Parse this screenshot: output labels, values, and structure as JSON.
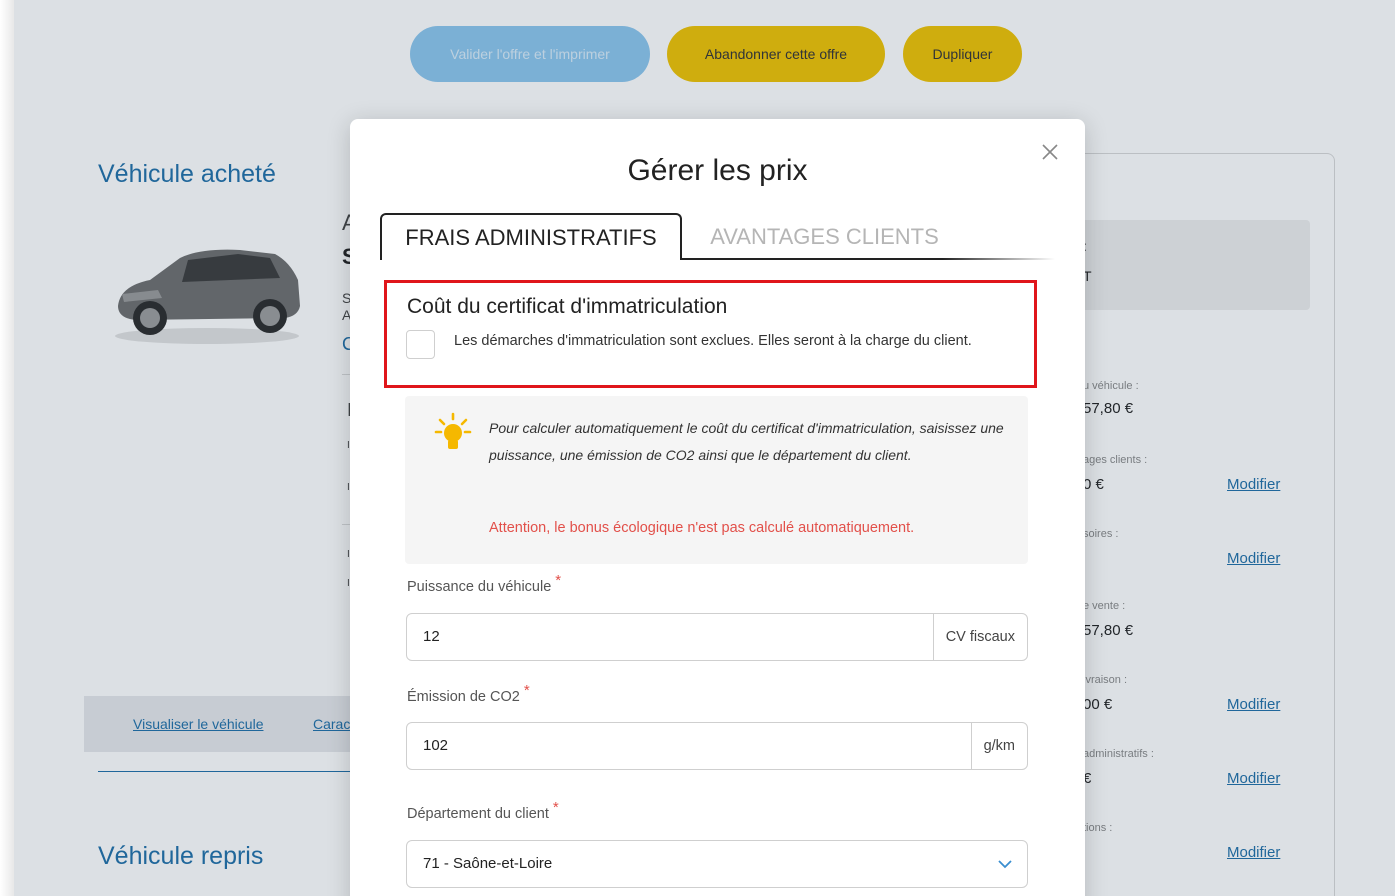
{
  "top_actions": {
    "validate_label": "Valider l'offre et l'imprimer",
    "abandon_label": "Abandonner cette offre",
    "duplicate_label": "Dupliquer"
  },
  "background": {
    "purchased_title": "Véhicule acheté",
    "trade_in_title": "Véhicule repris",
    "visualize_link": "Visualiser le véhicule",
    "features_link_partial": "Carac",
    "partial_letters": [
      "A",
      "S",
      "S",
      "A",
      "C",
      "I",
      "I",
      "I",
      "I",
      "I"
    ],
    "right_panel": {
      "gray_partial_1": ":",
      "gray_partial_2": "T",
      "rows": [
        {
          "label": "u véhicule :",
          "value": "57,80 €",
          "link": ""
        },
        {
          "label": "ages clients :",
          "value": "0 €",
          "link": "Modifier"
        },
        {
          "label": "soires :",
          "value": "",
          "link": "Modifier"
        },
        {
          "label": "e vente :",
          "value": "57,80 €",
          "link": ""
        },
        {
          "label": "ivraison :",
          "value": "00 €",
          "link": "Modifier"
        },
        {
          "label": "administratifs :",
          "value": "€",
          "link": "Modifier"
        },
        {
          "label": "tions :",
          "value": "",
          "link": "Modifier"
        }
      ]
    }
  },
  "modal": {
    "title": "Gérer les prix",
    "tabs": [
      {
        "label": "FRAIS ADMINISTRATIFS",
        "active": true
      },
      {
        "label": "AVANTAGES CLIENTS",
        "active": false
      }
    ],
    "registration": {
      "title": "Coût du certificat d'immatriculation",
      "checkbox_label": "Les démarches d'immatriculation sont exclues. Elles seront à la charge du client.",
      "checked": false
    },
    "info": {
      "text": "Pour calculer automatiquement le coût du certificat d'immatriculation, saisissez une puissance, une émission de CO2 ainsi que le département du client.",
      "warning": "Attention, le bonus écologique n'est pas calculé automatiquement."
    },
    "fields": {
      "power": {
        "label": "Puissance du véhicule",
        "required_mark": "*",
        "value": "12",
        "suffix": "CV fiscaux"
      },
      "co2": {
        "label": "Émission de CO2",
        "required_mark": "*",
        "value": "102",
        "suffix": "g/km"
      },
      "department": {
        "label": "Département du client",
        "required_mark": "*",
        "value": "71 - Saône-et-Loire"
      }
    }
  },
  "colors": {
    "brand_blue": "#1f6fa8",
    "yellow": "#f0c300",
    "alert_red": "#e0161b",
    "warning_text": "#e2504a"
  }
}
